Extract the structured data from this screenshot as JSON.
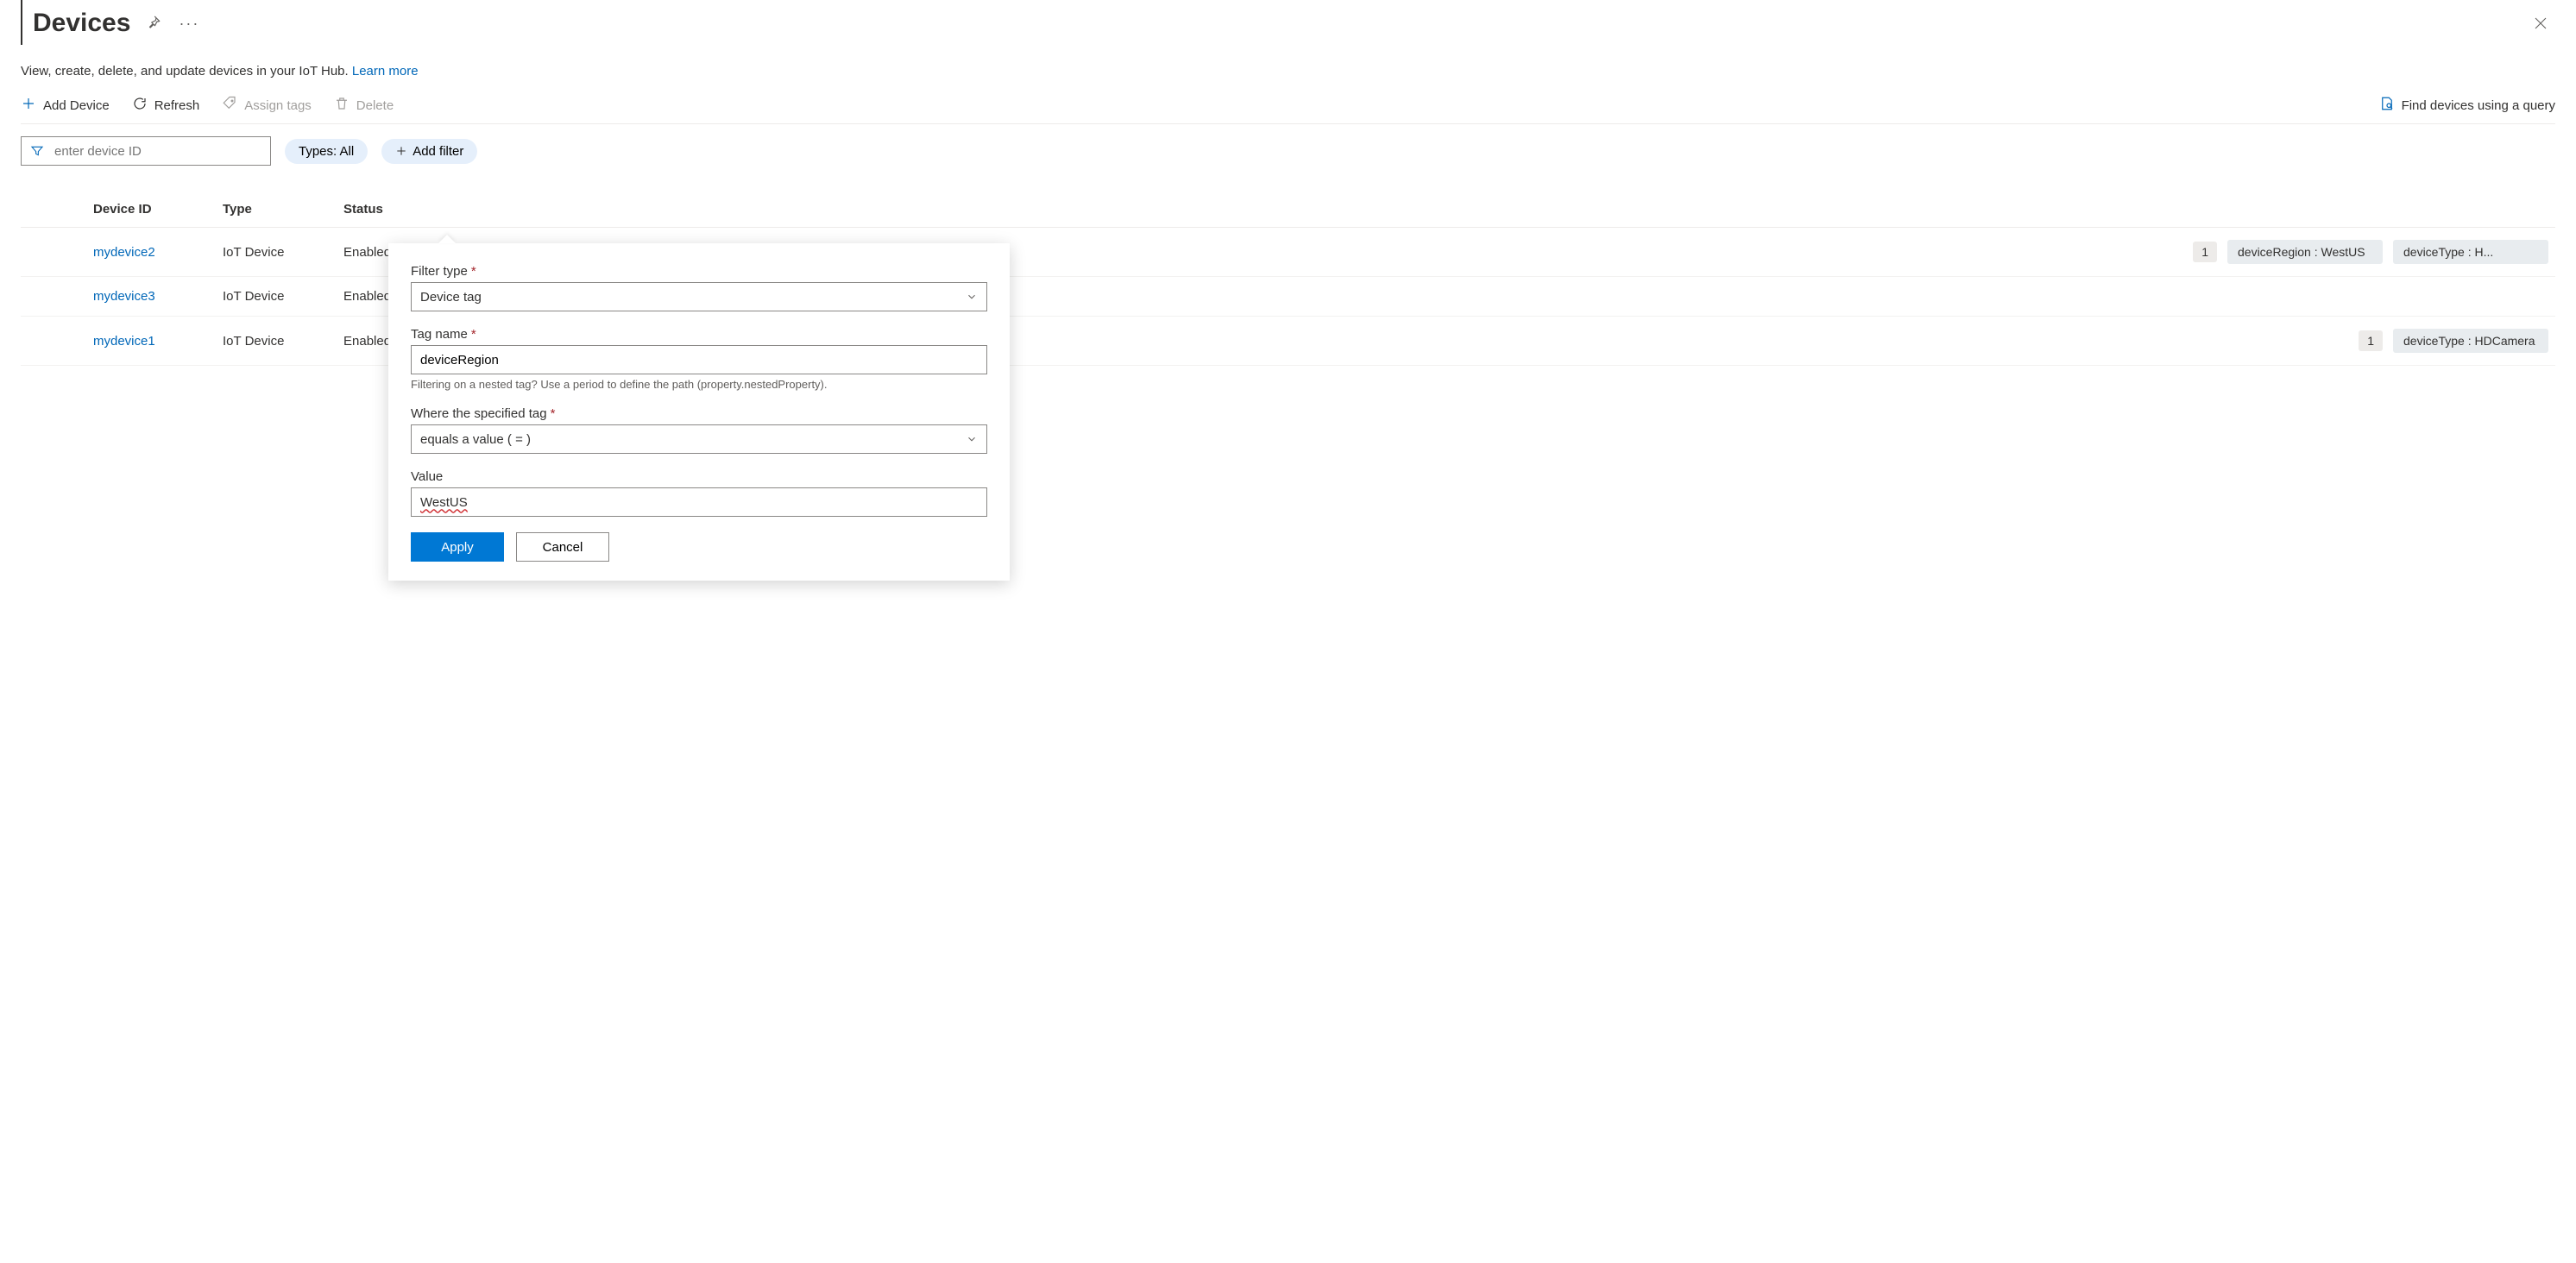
{
  "header": {
    "title": "Devices",
    "subtitle": "View, create, delete, and update devices in your IoT Hub. ",
    "learn_more": "Learn more"
  },
  "toolbar": {
    "add_device": "Add Device",
    "refresh": "Refresh",
    "assign_tags": "Assign tags",
    "delete": "Delete",
    "find_query": "Find devices using a query"
  },
  "filters": {
    "search_placeholder": "enter device ID",
    "types_pill": "Types: All",
    "add_filter": "Add filter"
  },
  "table": {
    "headers": {
      "device_id": "Device ID",
      "type": "Type",
      "status": "Status"
    },
    "rows": [
      {
        "id": "mydevice2",
        "type": "IoT Device",
        "status": "Enabled",
        "extra": "1",
        "tags": [
          "deviceRegion : WestUS",
          "deviceType : H..."
        ]
      },
      {
        "id": "mydevice3",
        "type": "IoT Device",
        "status": "Enabled",
        "extra": "",
        "tags": []
      },
      {
        "id": "mydevice1",
        "type": "IoT Device",
        "status": "Enabled",
        "extra": "1",
        "tags": [
          "deviceType : HDCamera"
        ]
      }
    ]
  },
  "popover": {
    "filter_type_label": "Filter type",
    "filter_type_value": "Device tag",
    "tag_name_label": "Tag name",
    "tag_name_value": "deviceRegion",
    "tag_name_hint": "Filtering on a nested tag? Use a period to define the path (property.nestedProperty).",
    "where_label": "Where the specified tag",
    "where_value": "equals a value ( = )",
    "value_label": "Value",
    "value_value": "WestUS",
    "apply": "Apply",
    "cancel": "Cancel"
  }
}
